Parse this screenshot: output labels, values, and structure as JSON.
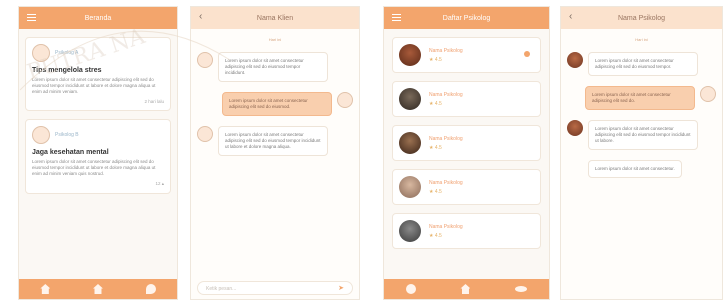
{
  "screens": {
    "feed": {
      "title": "Beranda",
      "posts": [
        {
          "author": "Psikolog A",
          "title": "Tips mengelola stres",
          "body": "Lorem ipsum dolor sit amet consectetur adipiscing elit sed do eiusmod tempor incididunt ut labore et dolore magna aliqua ut enim ad minim veniam.",
          "meta": "2 hari lalu"
        },
        {
          "author": "Psikolog B",
          "title": "Jaga kesehatan mental",
          "body": "Lorem ipsum dolor sit amet consectetur adipiscing elit sed do eiusmod tempor incididunt ut labore et dolore magna aliqua ut enim ad minim veniam quis nostrud.",
          "meta": "12 ▴"
        }
      ]
    },
    "chat1": {
      "title": "Nama Klien",
      "date": "Hari ini",
      "messages": [
        {
          "side": "left",
          "text": "Lorem ipsum dolor sit amet consectetur adipiscing elit sed do eiusmod tempor incididunt."
        },
        {
          "side": "right",
          "text": "Lorem ipsum dolor sit amet consectetur adipiscing elit sed do eiusmod."
        },
        {
          "side": "left",
          "text": "Lorem ipsum dolor sit amet consectetur adipiscing elit sed do eiusmod tempor incididunt ut labore et dolore magna aliqua."
        }
      ],
      "input_placeholder": "Ketik pesan..."
    },
    "contacts": {
      "title": "Daftar Psikolog",
      "items": [
        {
          "name": "Nama Psikolog",
          "rating": "★ 4.5"
        },
        {
          "name": "Nama Psikolog",
          "rating": "★ 4.5"
        },
        {
          "name": "Nama Psikolog",
          "rating": "★ 4.5"
        },
        {
          "name": "Nama Psikolog",
          "rating": "★ 4.5"
        },
        {
          "name": "Nama Psikolog",
          "rating": "★ 4.5"
        }
      ]
    },
    "chat2": {
      "title": "Nama Psikolog",
      "date": "Hari ini",
      "messages": [
        {
          "side": "left",
          "text": "Lorem ipsum dolor sit amet consectetur adipiscing elit sed do eiusmod tempor."
        },
        {
          "side": "right",
          "text": "Lorem ipsum dolor sit amet consectetur adipiscing elit sed do."
        },
        {
          "side": "left",
          "text": "Lorem ipsum dolor sit amet consectetur adipiscing elit sed do eiusmod tempor incididunt ut labore."
        },
        {
          "side": "left",
          "text": "Lorem ipsum dolor sit amet consectetur."
        }
      ]
    }
  },
  "watermark": "PUTRA NA",
  "accent": "#f3a56c"
}
